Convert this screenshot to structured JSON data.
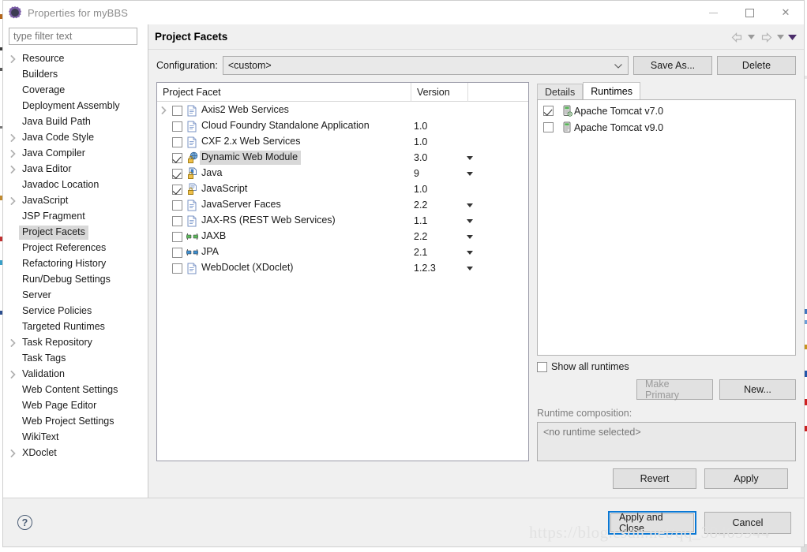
{
  "window": {
    "title": "Properties for myBBS",
    "icon": "properties-gear-icon",
    "minimize_label": "",
    "maximize_label": "",
    "close_label": "✕"
  },
  "sidebar": {
    "filter_placeholder": "type filter text",
    "filter_value": "",
    "items": [
      {
        "label": "Resource",
        "expandable": true,
        "selected": false
      },
      {
        "label": "Builders",
        "expandable": false,
        "selected": false
      },
      {
        "label": "Coverage",
        "expandable": false,
        "selected": false
      },
      {
        "label": "Deployment Assembly",
        "expandable": false,
        "selected": false
      },
      {
        "label": "Java Build Path",
        "expandable": false,
        "selected": false
      },
      {
        "label": "Java Code Style",
        "expandable": true,
        "selected": false
      },
      {
        "label": "Java Compiler",
        "expandable": true,
        "selected": false
      },
      {
        "label": "Java Editor",
        "expandable": true,
        "selected": false
      },
      {
        "label": "Javadoc Location",
        "expandable": false,
        "selected": false
      },
      {
        "label": "JavaScript",
        "expandable": true,
        "selected": false
      },
      {
        "label": "JSP Fragment",
        "expandable": false,
        "selected": false
      },
      {
        "label": "Project Facets",
        "expandable": false,
        "selected": true
      },
      {
        "label": "Project References",
        "expandable": false,
        "selected": false
      },
      {
        "label": "Refactoring History",
        "expandable": false,
        "selected": false
      },
      {
        "label": "Run/Debug Settings",
        "expandable": false,
        "selected": false
      },
      {
        "label": "Server",
        "expandable": false,
        "selected": false
      },
      {
        "label": "Service Policies",
        "expandable": false,
        "selected": false
      },
      {
        "label": "Targeted Runtimes",
        "expandable": false,
        "selected": false
      },
      {
        "label": "Task Repository",
        "expandable": true,
        "selected": false
      },
      {
        "label": "Task Tags",
        "expandable": false,
        "selected": false
      },
      {
        "label": "Validation",
        "expandable": true,
        "selected": false
      },
      {
        "label": "Web Content Settings",
        "expandable": false,
        "selected": false
      },
      {
        "label": "Web Page Editor",
        "expandable": false,
        "selected": false
      },
      {
        "label": "Web Project Settings",
        "expandable": false,
        "selected": false
      },
      {
        "label": "WikiText",
        "expandable": false,
        "selected": false
      },
      {
        "label": "XDoclet",
        "expandable": true,
        "selected": false
      }
    ]
  },
  "page": {
    "title": "Project Facets",
    "nav_back_icon": "arrow-left-icon",
    "nav_back_caret_icon": "chevron-down-icon",
    "nav_forward_icon": "arrow-right-icon",
    "nav_forward_caret_icon": "chevron-down-icon",
    "view_menu_icon": "view-menu-caret-icon"
  },
  "configuration": {
    "label": "Configuration:",
    "value": "<custom>",
    "save_as_label": "Save As...",
    "delete_label": "Delete"
  },
  "facets": {
    "columns": [
      "Project Facet",
      "Version"
    ],
    "rows": [
      {
        "name": "Axis2 Web Services",
        "version": "",
        "checked": false,
        "expandable": true,
        "has_version_caret": false,
        "icon": "document-icon",
        "selected": false
      },
      {
        "name": "Cloud Foundry Standalone Application",
        "version": "1.0",
        "checked": false,
        "expandable": false,
        "has_version_caret": false,
        "icon": "document-icon",
        "selected": false
      },
      {
        "name": "CXF 2.x Web Services",
        "version": "1.0",
        "checked": false,
        "expandable": false,
        "has_version_caret": false,
        "icon": "document-icon",
        "selected": false
      },
      {
        "name": "Dynamic Web Module",
        "version": "3.0",
        "checked": true,
        "expandable": false,
        "has_version_caret": true,
        "icon": "web-module-locked-icon",
        "selected": true
      },
      {
        "name": "Java",
        "version": "9",
        "checked": true,
        "expandable": false,
        "has_version_caret": true,
        "icon": "java-locked-icon",
        "selected": false
      },
      {
        "name": "JavaScript",
        "version": "1.0",
        "checked": true,
        "expandable": false,
        "has_version_caret": false,
        "icon": "javascript-locked-icon",
        "selected": false
      },
      {
        "name": "JavaServer Faces",
        "version": "2.2",
        "checked": false,
        "expandable": false,
        "has_version_caret": true,
        "icon": "document-icon",
        "selected": false
      },
      {
        "name": "JAX-RS (REST Web Services)",
        "version": "1.1",
        "checked": false,
        "expandable": false,
        "has_version_caret": true,
        "icon": "document-icon",
        "selected": false
      },
      {
        "name": "JAXB",
        "version": "2.2",
        "checked": false,
        "expandable": false,
        "has_version_caret": true,
        "icon": "green-arrows-icon",
        "selected": false
      },
      {
        "name": "JPA",
        "version": "2.1",
        "checked": false,
        "expandable": false,
        "has_version_caret": true,
        "icon": "blue-arrows-icon",
        "selected": false
      },
      {
        "name": "WebDoclet (XDoclet)",
        "version": "1.2.3",
        "checked": false,
        "expandable": false,
        "has_version_caret": true,
        "icon": "document-icon",
        "selected": false
      }
    ]
  },
  "details_panel": {
    "tabs": [
      {
        "label": "Details",
        "active": false
      },
      {
        "label": "Runtimes",
        "active": true
      }
    ],
    "runtimes": [
      {
        "label": "Apache Tomcat v7.0",
        "checked": true,
        "icon": "server-target-icon"
      },
      {
        "label": "Apache Tomcat v9.0",
        "checked": false,
        "icon": "server-icon"
      }
    ],
    "show_all_label": "Show all runtimes",
    "show_all_checked": false,
    "make_primary_label": "Make Primary",
    "make_primary_disabled": true,
    "new_label": "New...",
    "composition_label": "Runtime composition:",
    "composition_value": "<no runtime selected>"
  },
  "actions": {
    "revert_label": "Revert",
    "apply_label": "Apply",
    "apply_and_close_label": "Apply and Close",
    "cancel_label": "Cancel",
    "help_label": "?"
  },
  "watermark": "https://blog.csdn.net/qq_38409944",
  "colors": {
    "focus_blue": "#0a78d4",
    "selection_gray": "#d8d8d8",
    "panel_bg": "#f0f0f0"
  }
}
